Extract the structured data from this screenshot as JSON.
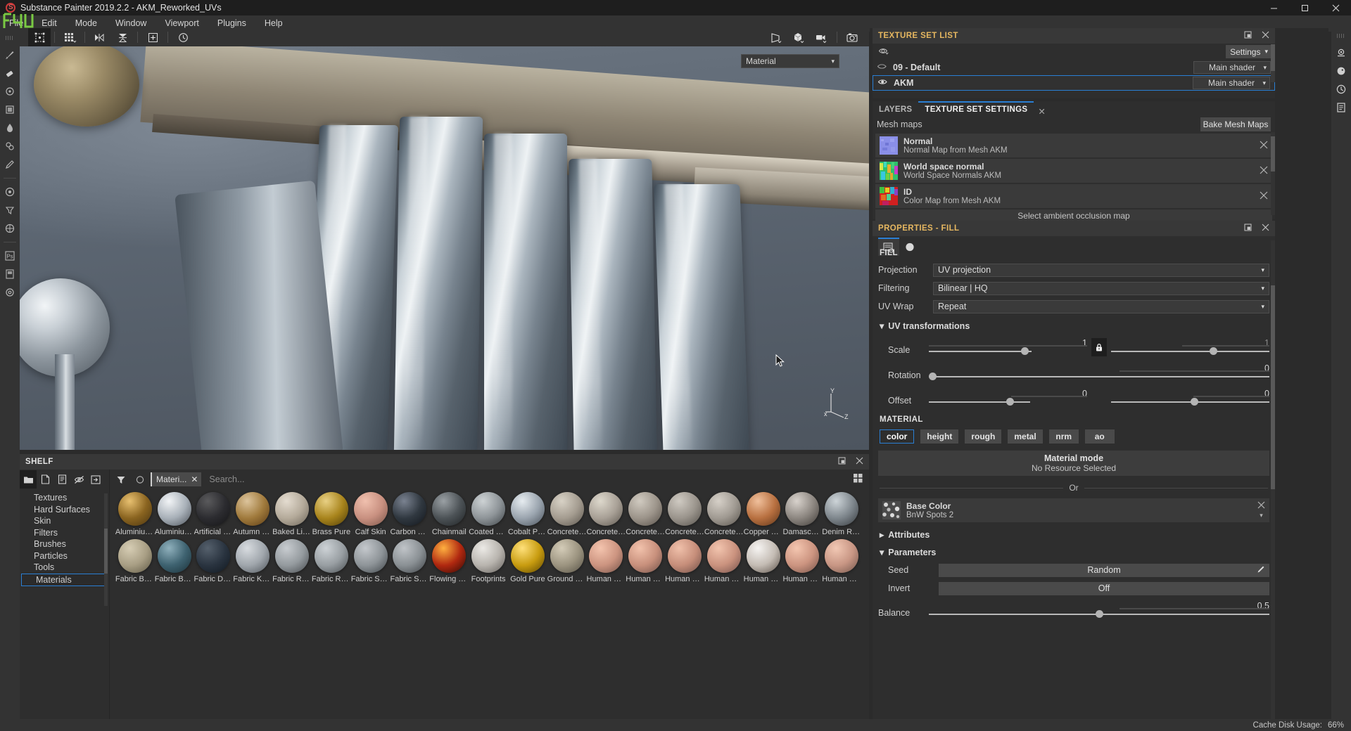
{
  "window": {
    "title": "Substance Painter 2019.2.2 - AKM_Reworked_UVs",
    "minimize": "–",
    "maximize": "❐",
    "close": "✕"
  },
  "menu": {
    "items": [
      {
        "label": "File"
      },
      {
        "label": "Edit"
      },
      {
        "label": "Mode"
      },
      {
        "label": "Window"
      },
      {
        "label": "Viewport"
      },
      {
        "label": "Plugins"
      },
      {
        "label": "Help"
      }
    ]
  },
  "viewport": {
    "material_selector": "Material",
    "axis": {
      "x": "x",
      "y": "Y",
      "z": "Z"
    },
    "toolbar_icons": [
      "uv-transform-icon",
      "grid-icon",
      "symmetry-icon",
      "symmetry-plane-icon",
      "snapping-icon",
      "undo-history-icon"
    ],
    "right_icons": [
      "display-settings-icon",
      "shader-settings-icon",
      "camera-settings-icon",
      "screenshot-icon"
    ]
  },
  "left_rail": {
    "tools": [
      "paint-brush-icon",
      "eraser-icon",
      "projection-icon",
      "polygon-fill-icon",
      "smudge-icon",
      "clone-stamp-icon",
      "color-picker-icon",
      "material-icon",
      "filter-icon",
      "generator-icon",
      "photoshop-icon",
      "plugin-icon",
      "settings-icon"
    ]
  },
  "texture_set_list": {
    "title": "TEXTURE SET LIST",
    "settings_label": "Settings",
    "rows": [
      {
        "name": "09 - Default",
        "shader": "Main shader",
        "visible": false,
        "selected": false
      },
      {
        "name": "AKM",
        "shader": "Main shader",
        "visible": true,
        "selected": true
      }
    ]
  },
  "tabs": {
    "items": [
      {
        "label": "LAYERS",
        "active": false
      },
      {
        "label": "TEXTURE SET SETTINGS",
        "active": true
      }
    ],
    "close": "✕"
  },
  "texture_set_settings": {
    "mesh_maps_label": "Mesh maps",
    "bake_button": "Bake Mesh Maps",
    "maps": [
      {
        "name": "Normal",
        "source": "Normal Map from Mesh AKM",
        "thumb": "normal-map-thumb"
      },
      {
        "name": "World space normal",
        "source": "World Space Normals AKM",
        "thumb": "world-space-normal-thumb"
      },
      {
        "name": "ID",
        "source": "Color Map from Mesh AKM",
        "thumb": "id-map-thumb"
      }
    ],
    "next_slot": "Select ambient occlusion map"
  },
  "properties": {
    "title": "PROPERTIES - FILL",
    "tabs": [
      "fill-properties-tab",
      "material-preview-tab"
    ],
    "fill": {
      "section": "FILL",
      "projection": {
        "label": "Projection",
        "value": "UV projection"
      },
      "filtering": {
        "label": "Filtering",
        "value": "Bilinear | HQ"
      },
      "uv_wrap": {
        "label": "UV Wrap",
        "value": "Repeat"
      }
    },
    "uv_transformations": {
      "title": "UV transformations",
      "scale": {
        "label": "Scale",
        "value_u": "1",
        "value_v": "1",
        "locked": true
      },
      "rotation": {
        "label": "Rotation",
        "value": "0"
      },
      "offset": {
        "label": "Offset",
        "value_u": "0",
        "value_v": "0"
      }
    },
    "material": {
      "section": "MATERIAL",
      "channels": [
        {
          "label": "color",
          "active": true
        },
        {
          "label": "height",
          "active": false
        },
        {
          "label": "rough",
          "active": false
        },
        {
          "label": "metal",
          "active": false
        },
        {
          "label": "nrm",
          "active": false
        },
        {
          "label": "ao",
          "active": false
        }
      ],
      "mode_title": "Material mode",
      "mode_sub": "No Resource Selected",
      "or": "Or",
      "resource": {
        "name": "Base Color",
        "value": "BnW Spots 2"
      }
    },
    "attributes": {
      "title": "Attributes",
      "expanded": false
    },
    "parameters": {
      "title": "Parameters",
      "expanded": true,
      "rows": [
        {
          "label": "Seed",
          "value": "Random",
          "type": "button-pen"
        },
        {
          "label": "Invert",
          "value": "Off",
          "type": "button"
        },
        {
          "label": "Balance",
          "value": "0.5",
          "type": "slider"
        }
      ]
    }
  },
  "shelf": {
    "title": "SHELF",
    "tool_icons": [
      "folder-icon",
      "new-icon",
      "document-icon",
      "hide-icon",
      "import-icon"
    ],
    "filter_icon": "funnel-icon",
    "refresh_icon": "refresh-icon",
    "chip": "Materi...",
    "chip_close": "✕",
    "search_placeholder": "Search...",
    "grid_icon": "grid-view-icon",
    "categories": [
      {
        "label": "Textures",
        "selected": false
      },
      {
        "label": "Hard Surfaces",
        "selected": false
      },
      {
        "label": "Skin",
        "selected": false
      },
      {
        "label": "Filters",
        "selected": false
      },
      {
        "label": "Brushes",
        "selected": false
      },
      {
        "label": "Particles",
        "selected": false
      },
      {
        "label": "Tools",
        "selected": false
      },
      {
        "label": "Materials",
        "selected": true
      }
    ],
    "row1": [
      {
        "label": "Aluminium ...",
        "c1": "#e8c070",
        "c2": "#8a6420",
        "c3": "#4a3410"
      },
      {
        "label": "Aluminium ...",
        "c1": "#f2f4f6",
        "c2": "#a8b0b8",
        "c3": "#4a5058"
      },
      {
        "label": "Artificial Lea...",
        "c1": "#5a5a5c",
        "c2": "#2c2c30",
        "c3": "#141416"
      },
      {
        "label": "Autumn Leaf",
        "c1": "#dcc49c",
        "c2": "#a07a3c",
        "c3": "#5a3a14"
      },
      {
        "label": "Baked Light...",
        "c1": "#e4dcd0",
        "c2": "#b4aa9a",
        "c3": "#6c6458"
      },
      {
        "label": "Brass Pure",
        "c1": "#e8d084",
        "c2": "#a8841c",
        "c3": "#4e3c08"
      },
      {
        "label": "Calf Skin",
        "c1": "#f0c0ae",
        "c2": "#c89080",
        "c3": "#7a5448"
      },
      {
        "label": "Carbon Fiber",
        "c1": "#7a8290",
        "c2": "#303840",
        "c3": "#12161c"
      },
      {
        "label": "Chainmail",
        "c1": "#9aa0a4",
        "c2": "#4c5256",
        "c3": "#1e2224"
      },
      {
        "label": "Coated Metal",
        "c1": "#cdd2d4",
        "c2": "#8e9498",
        "c3": "#3c4246"
      },
      {
        "label": "Cobalt Pure",
        "c1": "#e6ecf0",
        "c2": "#9aa4ae",
        "c3": "#474f58"
      },
      {
        "label": "Concrete B...",
        "c1": "#d8d2c6",
        "c2": "#a49c90",
        "c3": "#5a544c"
      },
      {
        "label": "Concrete Cl...",
        "c1": "#ddd8cc",
        "c2": "#a8a096",
        "c3": "#5c564e"
      },
      {
        "label": "Concrete D...",
        "c1": "#d0cac0",
        "c2": "#9c948a",
        "c3": "#564f48"
      },
      {
        "label": "Concrete Si...",
        "c1": "#cfcac2",
        "c2": "#9a948c",
        "c3": "#54504a"
      },
      {
        "label": "Concrete S...",
        "c1": "#d6d0c8",
        "c2": "#a09a92",
        "c3": "#58534c"
      },
      {
        "label": "Copper Pure",
        "c1": "#f0c09c",
        "c2": "#b87040",
        "c3": "#5c3418"
      },
      {
        "label": "Damascus ...",
        "c1": "#d8d2cc",
        "c2": "#8c8680",
        "c3": "#3e3a36"
      },
      {
        "label": "Denim Rivet",
        "c1": "#cdd4d8",
        "c2": "#7e868c",
        "c3": "#34383c"
      }
    ],
    "row2": [
      {
        "label": "Fabric Bam...",
        "c1": "#d6cdb4",
        "c2": "#a89e84",
        "c3": "#5e5844"
      },
      {
        "label": "Fabric Base...",
        "c1": "#8fb0bc",
        "c2": "#3e6270",
        "c3": "#1a3038"
      },
      {
        "label": "Fabric Deni...",
        "c1": "#55606c",
        "c2": "#2a3440",
        "c3": "#101820"
      },
      {
        "label": "Fabric Knitt...",
        "c1": "#d8dce0",
        "c2": "#a0a6ac",
        "c3": "#4c5258"
      },
      {
        "label": "Fabric Rough",
        "c1": "#c8ccd0",
        "c2": "#949a9e",
        "c3": "#44484c"
      },
      {
        "label": "Fabric Rou...",
        "c1": "#cdd2d6",
        "c2": "#989ea2",
        "c3": "#474c50"
      },
      {
        "label": "Fabric Soft ...",
        "c1": "#c4c8cc",
        "c2": "#8e9498",
        "c3": "#3e4448"
      },
      {
        "label": "Fabric Suit ...",
        "c1": "#c0c4c8",
        "c2": "#8a9094",
        "c3": "#3c4044"
      },
      {
        "label": "Flowing Lav...",
        "c1": "#ffb040",
        "c2": "#b02810",
        "c3": "#300804"
      },
      {
        "label": "Footprints",
        "c1": "#eceae6",
        "c2": "#b8b4ae",
        "c3": "#605c58"
      },
      {
        "label": "Gold Pure",
        "c1": "#ffe07a",
        "c2": "#c89c10",
        "c3": "#5a4400"
      },
      {
        "label": "Ground Gra...",
        "c1": "#d4ccb8",
        "c2": "#9c9480",
        "c3": "#545044"
      },
      {
        "label": "Human Bac...",
        "c1": "#f4c4ae",
        "c2": "#cc9480",
        "c3": "#745248"
      },
      {
        "label": "Human Bell...",
        "c1": "#f2c2ac",
        "c2": "#c8907c",
        "c3": "#705048"
      },
      {
        "label": "Human Bu...",
        "c1": "#f0c0aa",
        "c2": "#c68e7a",
        "c3": "#6e4e46"
      },
      {
        "label": "Human Ch...",
        "c1": "#f2c4ae",
        "c2": "#ca927e",
        "c3": "#72504a"
      },
      {
        "label": "Human Eye...",
        "c1": "#f6f4f2",
        "c2": "#c4bcb4",
        "c3": "#5a5048"
      },
      {
        "label": "Human Fac...",
        "c1": "#f4c6b0",
        "c2": "#cc9480",
        "c3": "#745248"
      },
      {
        "label": "Human Fe...",
        "c1": "#f2c8b4",
        "c2": "#c89684",
        "c3": "#70544a"
      }
    ]
  },
  "status_bar": {
    "cache_label": "Cache Disk Usage:",
    "cache_value": "66%"
  },
  "colors": {
    "accent_blue": "#2a7fd4",
    "panel_title": "#e6b760",
    "panel_bg": "#2e2e2e",
    "header_bg": "#383838",
    "rail_bg": "#333333"
  }
}
